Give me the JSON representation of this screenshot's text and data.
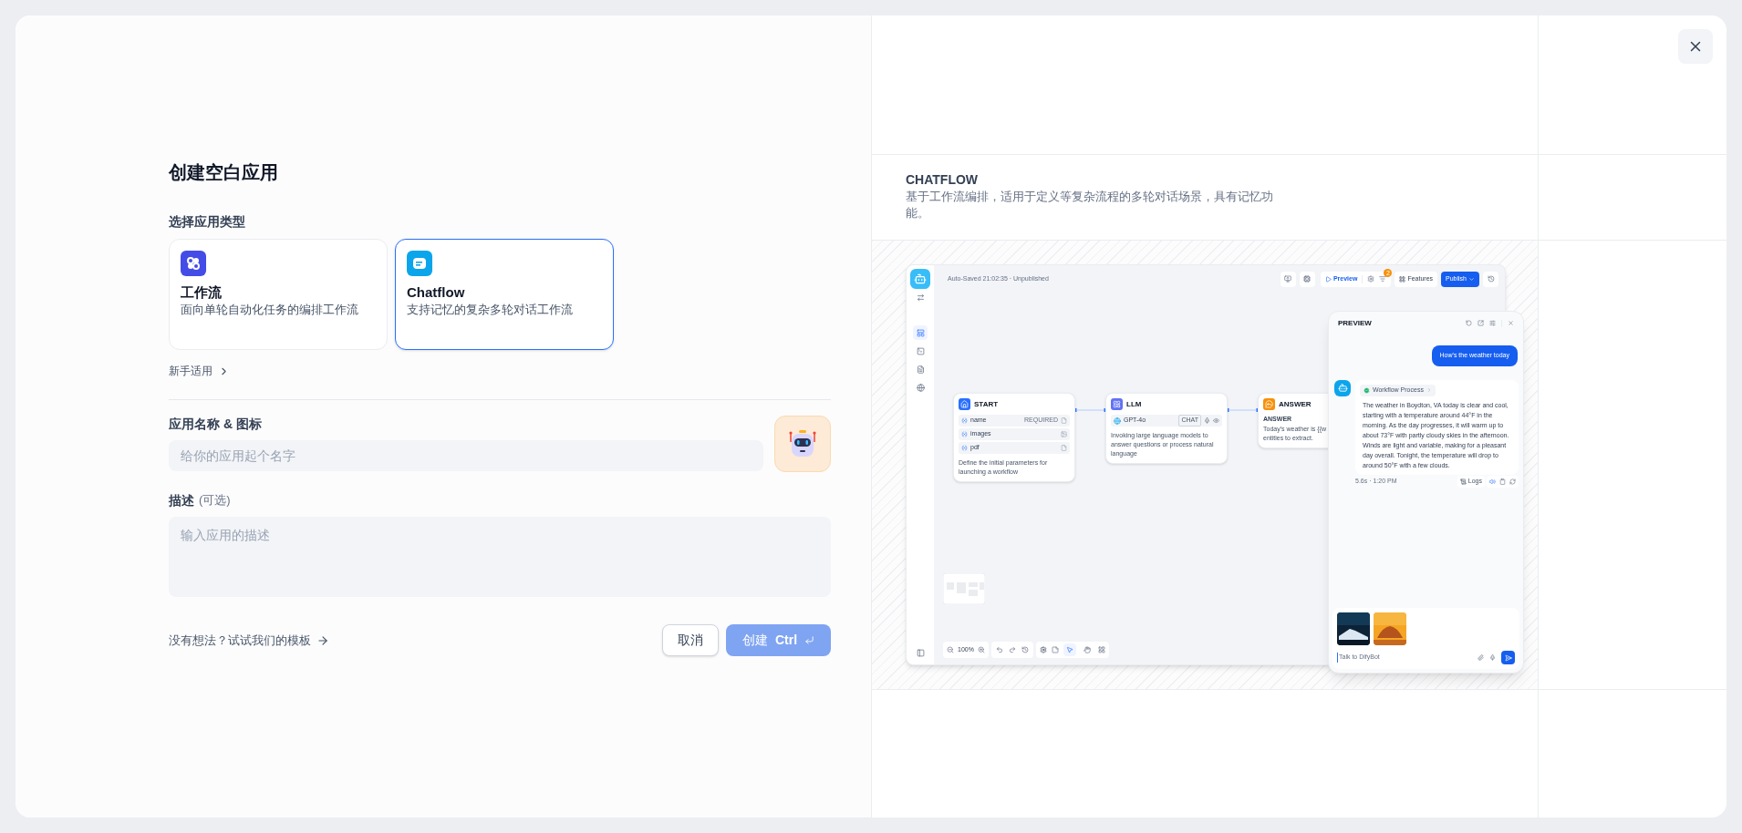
{
  "dialog": {
    "title": "创建空白应用"
  },
  "app_type": {
    "label": "选择应用类型",
    "options": [
      {
        "kind": "workflow",
        "title": "工作流",
        "description": "面向单轮自动化任务的编排工作流",
        "selected": false
      },
      {
        "kind": "chatflow",
        "title": "Chatflow",
        "description": "支持记忆的复杂多轮对话工作流",
        "selected": true
      }
    ],
    "beginner_link": "新手适用"
  },
  "name_field": {
    "label": "应用名称 & 图标",
    "placeholder": "给你的应用起个名字"
  },
  "description_field": {
    "label": "描述",
    "optional": "(可选)",
    "placeholder": "输入应用的描述"
  },
  "template_link": "没有想法？试试我们的模板",
  "buttons": {
    "cancel": "取消",
    "create": {
      "label": "创建",
      "shortcut": "Ctrl",
      "disabled": true
    }
  },
  "preview": {
    "title": "CHATFLOW",
    "description": "基于工作流编排，适用于定义等复杂流程的多轮对话场景，具有记忆功能。",
    "screenshot": {
      "status": "Auto-Saved 21:02:35 · Unpublished",
      "toolbar": {
        "preview": "Preview",
        "badge": "2",
        "features": "Features",
        "publish": "Publish"
      },
      "sidebar": [
        {
          "kind": "layout",
          "selected": true
        },
        {
          "kind": "terminal",
          "selected": false
        },
        {
          "kind": "file",
          "selected": false
        },
        {
          "kind": "globe",
          "selected": false
        }
      ],
      "nodes": [
        {
          "kind": "start",
          "title": "START",
          "variables": [
            {
              "name": "name",
              "tag": "REQUIRED"
            },
            {
              "name": "images"
            },
            {
              "name": "pdf"
            }
          ],
          "description": "Define the initial parameters for launching a workflow"
        },
        {
          "kind": "llm",
          "title": "LLM",
          "model": "GPT-4o",
          "mode": "CHAT",
          "description": "Invoking large language models to answer questions or process natural language"
        },
        {
          "kind": "answer",
          "title": "ANSWER",
          "field": "ANSWER",
          "lines": [
            "Today's weather is {{w",
            "entities to extract."
          ]
        }
      ],
      "zoom": "100%",
      "tools": [
        {
          "kind": "pointer",
          "selected": true
        },
        {
          "kind": "hand",
          "selected": false
        }
      ],
      "chat": {
        "title": "PREVIEW",
        "question": "How's the weather today",
        "process": "Workflow Process",
        "answer": "The weather in Boydton, VA today is clear and cool, starting with a temperature around 44°F in the morning. As the day progresses, it will warm up to about 73°F with partly cloudy skies in the afternoon. Winds are light and variable, making for a pleasant day overall. Tonight, the temperature will drop to around 50°F with a few clouds.",
        "meta": "5.6s · 1:20 PM",
        "logs": "Logs",
        "placeholder": "Talk to DifyBot"
      }
    }
  }
}
